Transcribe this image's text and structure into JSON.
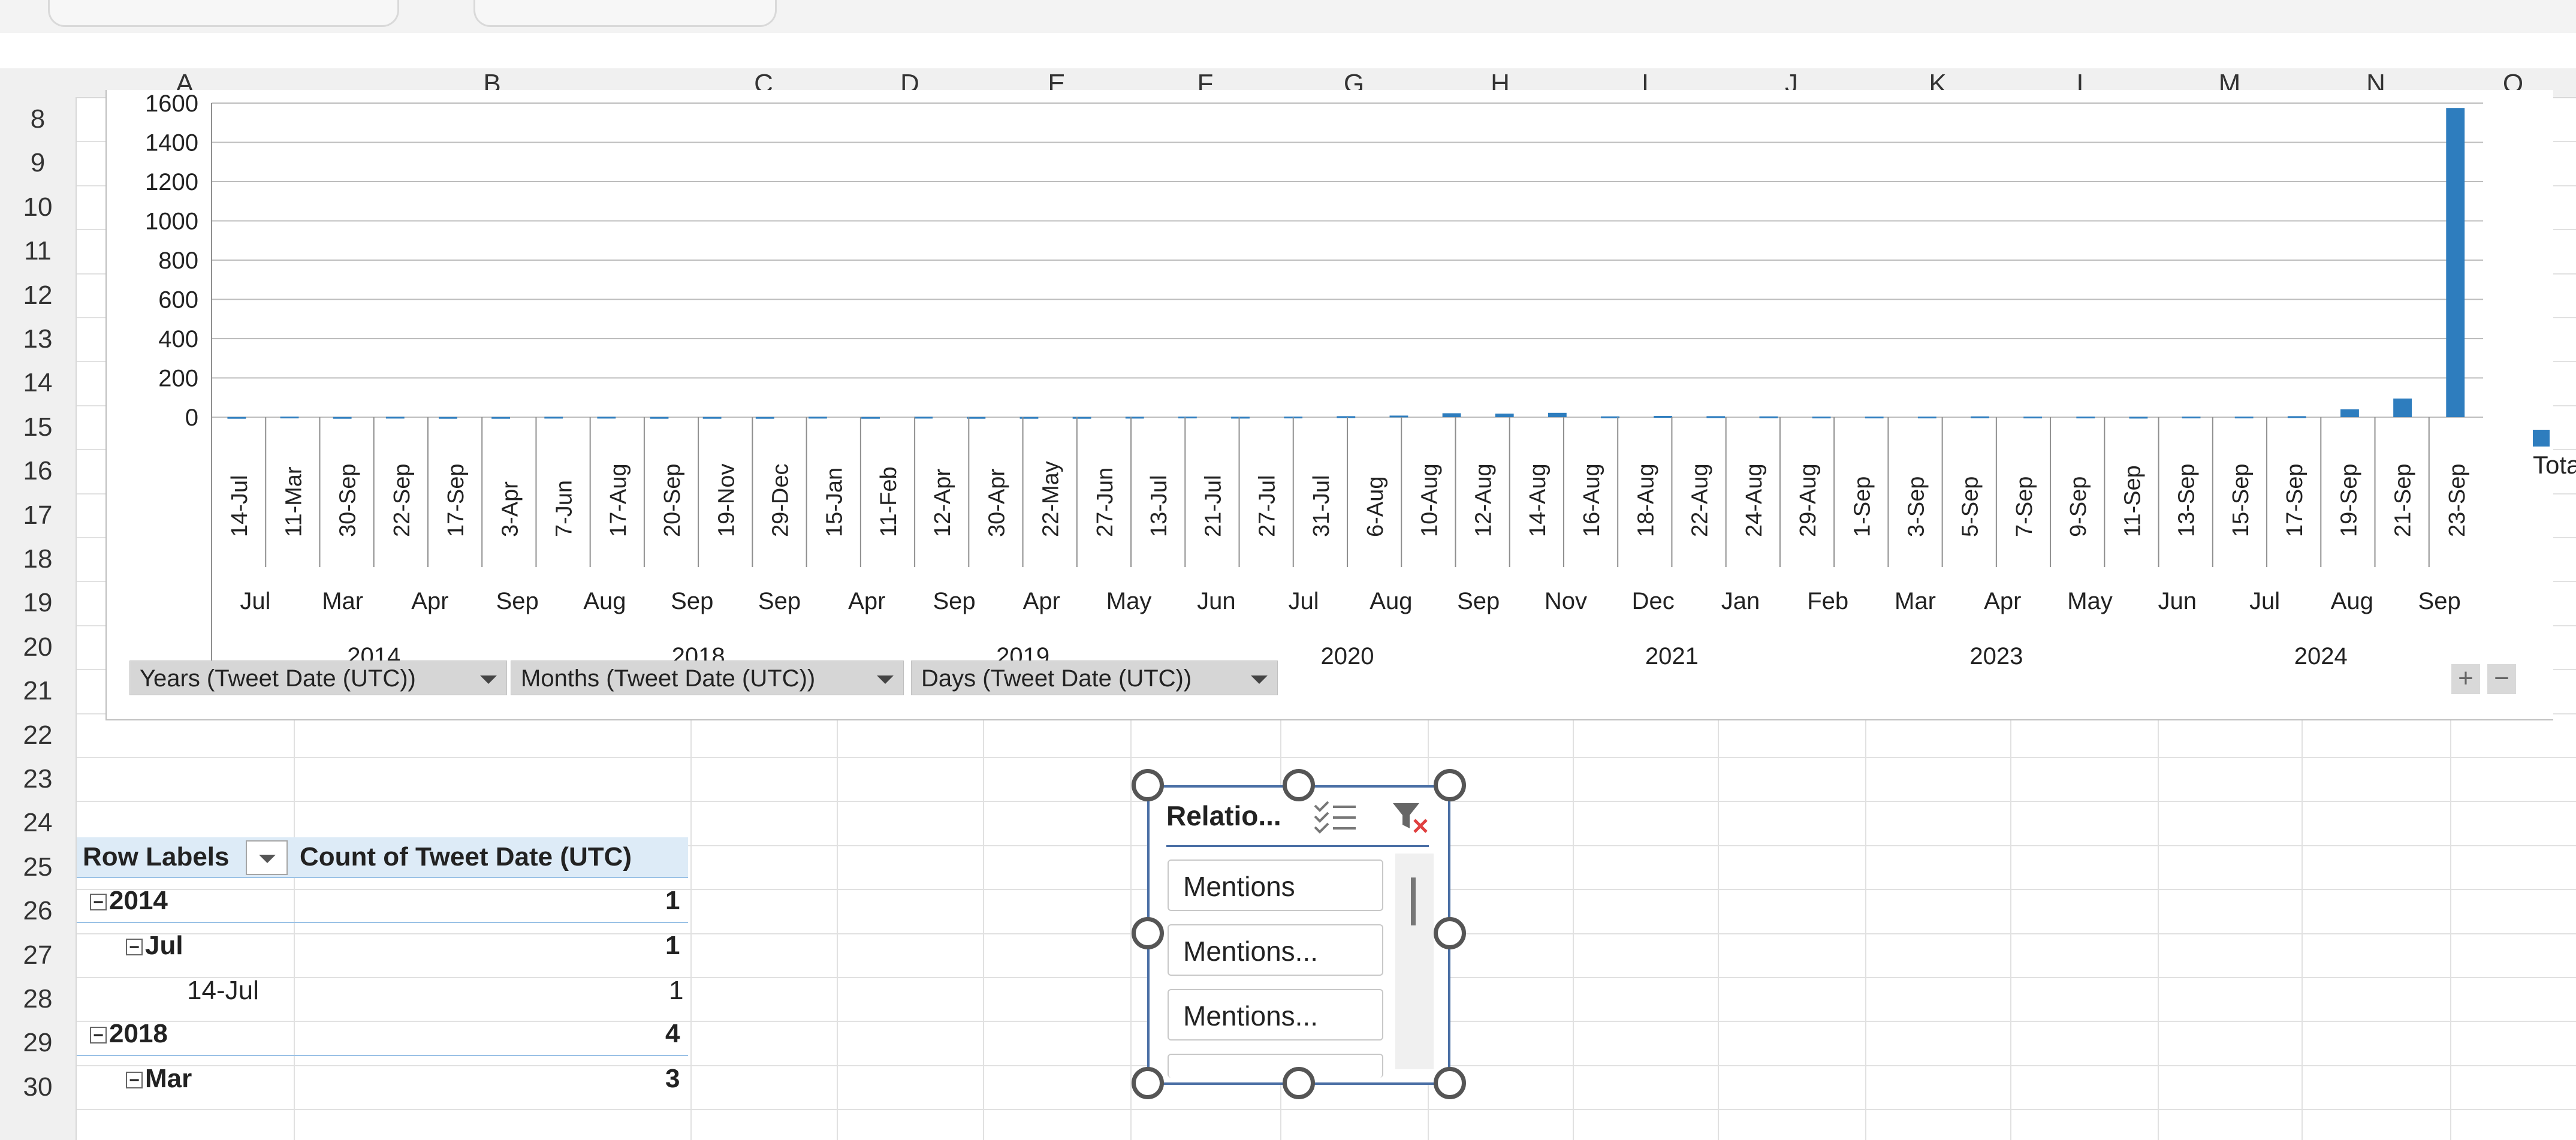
{
  "columns": [
    "A",
    "B",
    "C",
    "D",
    "E",
    "F",
    "G",
    "H",
    "I",
    "J",
    "K",
    "L",
    "M",
    "N",
    "O"
  ],
  "rows": [
    "8",
    "9",
    "10",
    "11",
    "12",
    "13",
    "14",
    "15",
    "16",
    "17",
    "18",
    "19",
    "20",
    "21",
    "22",
    "23",
    "24",
    "25",
    "26",
    "27",
    "28",
    "29",
    "30"
  ],
  "chart_data": {
    "type": "bar",
    "title": "",
    "y_ticks": [
      "0",
      "200",
      "400",
      "600",
      "800",
      "1000",
      "1200",
      "1400",
      "1600"
    ],
    "ylim": [
      0,
      1600
    ],
    "legend": {
      "entries": [
        "Total"
      ],
      "placement": "right"
    },
    "series": [
      {
        "name": "Total",
        "color": "#2e7dbe"
      }
    ],
    "days": [
      "14-Jul",
      "11-Mar",
      "30-Sep",
      "22-Sep",
      "17-Sep",
      "3-Apr",
      "7-Jun",
      "17-Aug",
      "20-Sep",
      "19-Nov",
      "29-Dec",
      "15-Jan",
      "11-Feb",
      "12-Apr",
      "30-Apr",
      "22-May",
      "27-Jun",
      "13-Jul",
      "21-Jul",
      "27-Jul",
      "31-Jul",
      "6-Aug",
      "10-Aug",
      "12-Aug",
      "14-Aug",
      "16-Aug",
      "18-Aug",
      "22-Aug",
      "24-Aug",
      "29-Aug",
      "1-Sep",
      "3-Sep",
      "5-Sep",
      "7-Sep",
      "9-Sep",
      "11-Sep",
      "13-Sep",
      "15-Sep",
      "17-Sep",
      "19-Sep",
      "21-Sep",
      "23-Sep"
    ],
    "values": [
      1,
      3,
      1,
      2,
      1,
      1,
      2,
      2,
      1,
      1,
      1,
      2,
      1,
      2,
      1,
      1,
      1,
      2,
      3,
      2,
      3,
      5,
      8,
      20,
      18,
      22,
      4,
      6,
      5,
      4,
      3,
      3,
      3,
      4,
      3,
      3,
      2,
      3,
      3,
      5,
      40,
      95,
      1575
    ],
    "months": [
      "Jul",
      "Mar",
      "Apr",
      "Sep",
      "Aug",
      "Sep",
      "Sep",
      "Apr",
      "Sep",
      "Apr",
      "May",
      "Jun",
      "Jul",
      "Aug",
      "Sep",
      "Nov",
      "Dec",
      "Jan",
      "Feb",
      "Mar",
      "Apr",
      "May",
      "Jun",
      "Jul",
      "Aug",
      "Sep"
    ],
    "years": [
      "2014",
      "2018",
      "2019",
      "2020",
      "2021",
      "2023",
      "2024"
    ]
  },
  "field_buttons": [
    {
      "label": "Years (Tweet Date (UTC))"
    },
    {
      "label": "Months (Tweet Date (UTC))"
    },
    {
      "label": "Days (Tweet Date (UTC))"
    }
  ],
  "zoom": {
    "expand": "+",
    "collapse": "−"
  },
  "pivot": {
    "row_labels_header": "Row Labels",
    "count_header": "Count of Tweet Date (UTC)",
    "rows": [
      {
        "label": "2014",
        "value": "1"
      },
      {
        "label": "Jul",
        "value": "1"
      },
      {
        "label": "14-Jul",
        "value": "1"
      },
      {
        "label": "2018",
        "value": "4"
      },
      {
        "label": "Mar",
        "value": "3"
      }
    ]
  },
  "slicer": {
    "title": "Relatio...",
    "items": [
      "Mentions",
      "Mentions...",
      "Mentions..."
    ]
  }
}
